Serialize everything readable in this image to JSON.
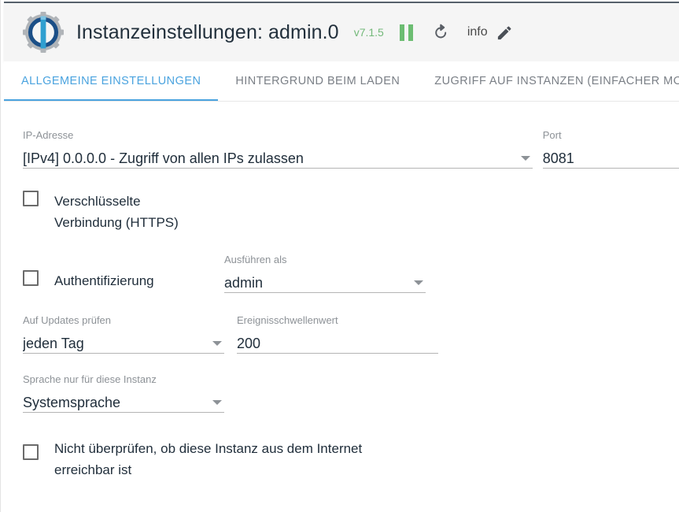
{
  "header": {
    "logo_icon": "iobroker-gear-logo",
    "title": "Instanzeinstellungen: admin.0",
    "version": "v7.1.5",
    "pause_icon": "pause-icon",
    "refresh_icon": "refresh-icon",
    "info_label": "info",
    "edit_icon": "pencil-edit-icon",
    "colors": {
      "version_green": "#74b97a",
      "pause_green": "#6cbd72",
      "accent_blue": "#4aa3df",
      "logo_ring": "#1b4f87",
      "logo_bar": "#2f9fd0",
      "logo_gear": "#b0b4b8"
    }
  },
  "tabs": [
    {
      "label": "ALLGEMEINE EINSTELLUNGEN",
      "active": true
    },
    {
      "label": "HINTERGRUND BEIM LADEN",
      "active": false
    },
    {
      "label": "ZUGRIFF AUF INSTANZEN (EINFACHER MODUS)",
      "active": false
    }
  ],
  "form": {
    "ip_address": {
      "label": "IP-Adresse",
      "value": "[IPv4] 0.0.0.0 - Zugriff von allen IPs zulassen",
      "caret_icon": "chevron-down-icon"
    },
    "port": {
      "label": "Port",
      "value": "8081"
    },
    "https": {
      "label": "Verschlüsselte Verbindung (HTTPS)",
      "label_line1": "Verschlüsselte",
      "label_line2": "Verbindung (HTTPS)",
      "checked": false
    },
    "authentication": {
      "label": "Authentifizierung",
      "checked": false
    },
    "run_as": {
      "label": "Ausführen als",
      "value": "admin",
      "caret_icon": "chevron-down-icon"
    },
    "check_updates": {
      "label": "Auf Updates prüfen",
      "value": "jeden Tag",
      "caret_icon": "chevron-down-icon"
    },
    "event_threshold": {
      "label": "Ereignisschwellenwert",
      "value": "200"
    },
    "language": {
      "label": "Sprache nur für diese Instanz",
      "value": "Systemsprache",
      "caret_icon": "chevron-down-icon"
    },
    "no_internet_check": {
      "label": "Nicht überprüfen, ob diese Instanz aus dem Internet erreichbar ist",
      "label_line1": "Nicht überprüfen, ob diese Instanz aus dem Internet",
      "label_line2": "erreichbar ist",
      "checked": false
    }
  }
}
